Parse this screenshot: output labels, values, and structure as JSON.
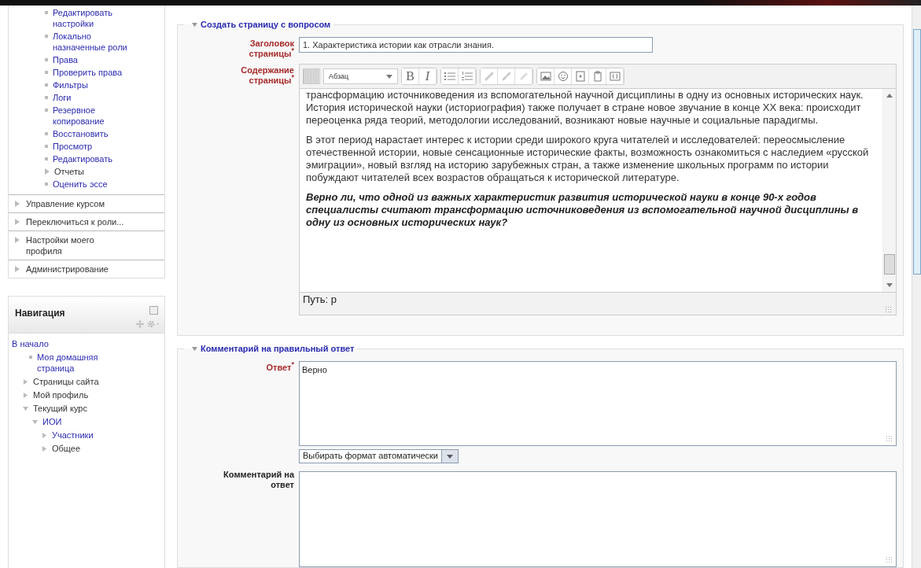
{
  "settings_block": {
    "items": [
      {
        "label": "Редактировать настройки",
        "kind": "bullet",
        "link": true
      },
      {
        "label": "Локально назначенные роли",
        "kind": "bullet",
        "link": true
      },
      {
        "label": "Права",
        "kind": "bullet",
        "link": true
      },
      {
        "label": "Проверить права",
        "kind": "bullet",
        "link": true
      },
      {
        "label": "Фильтры",
        "kind": "bullet",
        "link": true
      },
      {
        "label": "Логи",
        "kind": "bullet",
        "link": true
      },
      {
        "label": "Резервное копирование",
        "kind": "bullet",
        "link": true
      },
      {
        "label": "Восстановить",
        "kind": "bullet",
        "link": true
      },
      {
        "label": "Просмотр",
        "kind": "bullet",
        "link": true
      },
      {
        "label": "Редактировать",
        "kind": "bullet",
        "link": true
      },
      {
        "label": "Отчеты",
        "kind": "branch",
        "link": false
      },
      {
        "label": "Оценить эссе",
        "kind": "bullet",
        "link": true
      }
    ],
    "sections": [
      {
        "label": "Управление курсом"
      },
      {
        "label": "Переключиться к роли..."
      },
      {
        "label": "Настройки моего профиля"
      },
      {
        "label": "Администрирование"
      }
    ]
  },
  "navigation": {
    "title": "Навигация",
    "items": [
      {
        "label": "В начало",
        "link": true,
        "children": [
          {
            "label": "Моя домашняя страница",
            "kind": "bullet",
            "link": true
          },
          {
            "label": "Страницы сайта",
            "kind": "branch",
            "link": false,
            "expanded": false
          },
          {
            "label": "Мой профиль",
            "kind": "branch",
            "link": false,
            "expanded": false
          },
          {
            "label": "Текущий курс",
            "kind": "branch",
            "link": false,
            "expanded": true,
            "children": [
              {
                "label": "ИОИ",
                "kind": "branch",
                "link": true,
                "expanded": true,
                "children": [
                  {
                    "label": "Участники",
                    "kind": "branch",
                    "link": true,
                    "expanded": false
                  },
                  {
                    "label": "Общее",
                    "kind": "branch",
                    "link": false,
                    "expanded": false
                  }
                ]
              }
            ]
          }
        ]
      }
    ]
  },
  "page_section": {
    "legend": "Создать страницу с вопросом",
    "expanded": true,
    "title_field": {
      "label": "Заголовок страницы$^{*}$",
      "required": true,
      "value": "1. Характеристика истории как отрасли знания."
    },
    "content_field": {
      "label": "Содержание страницы$^{*}$",
      "required": true,
      "toolbar": {
        "format": "Абзац",
        "bold": "B",
        "italic": "I"
      },
      "paragraphs": [
        {
          "kind": "normal",
          "text": "трансформацию источниковедения из вспомогательной научной дисциплины в одну из основных исторических наук. История исторической науки (историография) также получает в стране новое звучание в конце XX века: происходит переоценка ряда теорий, методологии исследований, возникают новые научные и социальные парадигмы."
        },
        {
          "kind": "normal",
          "text": "В этот период нарастает интерес к истории среди широкого круга читателей и исследователей: переосмысление отечественной истории, новые сенсационные исторические факты, возможность ознакомиться с наследием «русской эмиграции», новый взгляд на историю зарубежных стран, а также изменение школьных программ по истории побуждают читателей всех возрастов обращаться к исторической литературе."
        },
        {
          "kind": "question",
          "text": "Верно ли, что одной из важных характеристик развития исторической науки в конце 90-х годов специалисты считают трансформацию источниковедения из вспомогательной научной дисциплины в одну из основных исторических наук?"
        }
      ],
      "path": "Путь: p"
    }
  },
  "answer_section": {
    "legend": "Комментарий на правильный ответ",
    "expanded": true,
    "answer_field": {
      "label": "Ответ$^{*}$",
      "required": true,
      "value": "Верно",
      "format": "Выбирать формат автоматически"
    },
    "comment_field": {
      "label": "Комментарий на ответ",
      "required": false
    }
  }
}
